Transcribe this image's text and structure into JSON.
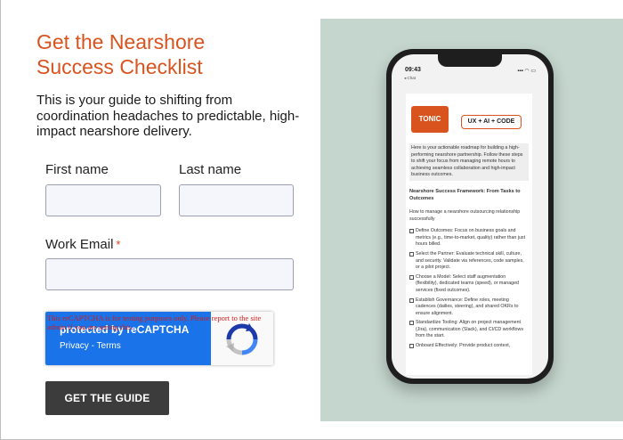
{
  "form": {
    "title_line1": "Get the Nearshore",
    "title_line2": "Success Checklist",
    "intro": "This is your guide to shifting from coordination headaches to predictable, high-impact nearshore delivery.",
    "first_name_label": "First name",
    "first_name_value": "",
    "last_name_label": "Last name",
    "last_name_value": "",
    "email_label": "Work Email",
    "email_required": "*",
    "email_value": "",
    "submit_label": "GET THE GUIDE"
  },
  "recaptcha": {
    "warning": "This reCAPTCHA is for testing purposes only. Please report to the site admin if you are seeing this.",
    "protected_label": "protected by reCAPTCHA",
    "privacy": "Privacy",
    "separator": "-",
    "terms": "Terms",
    "logo_icon": "recaptcha-icon"
  },
  "preview": {
    "panel_color": "#c4d6ce",
    "phone": {
      "time": "09:43",
      "back_label": "◂ Chat",
      "status_icons": "▪▪▪ ◠ ▭"
    },
    "doc": {
      "brand": "TONIC",
      "badge": "UX + AI + CODE",
      "summary": "Here is your actionable roadmap for building a high-performing nearshore partnership. Follow these steps to shift your focus from managing remote hours to achieving seamless collaboration and high-impact business outcomes.",
      "heading": "Nearshore Success Framework: From Tasks to Outcomes",
      "subheading": "How to manage a nearshore outsourcing relationship successfully",
      "items": [
        "Define Outcomes: Focus on business goals and metrics (e.g., time-to-market, quality) rather than just hours billed.",
        "Select the Partner: Evaluate technical skill, culture, and security. Validate via references, code samples, or a pilot project.",
        "Choose a Model: Select staff augmentation (flexibility), dedicated teams (speed), or managed services (fixed outcomes).",
        "Establish Governance: Define roles, meeting cadences (dailies, steering), and shared OKRs to ensure alignment.",
        "Standardize Tooling: Align on project management (Jira), communication (Slack), and CI/CD workflows from the start.",
        "Onboard Effectively: Provide product context,"
      ]
    }
  },
  "colors": {
    "accent": "#d9531e",
    "button": "#3c3c3c",
    "recaptcha_blue": "#1a73e8"
  }
}
